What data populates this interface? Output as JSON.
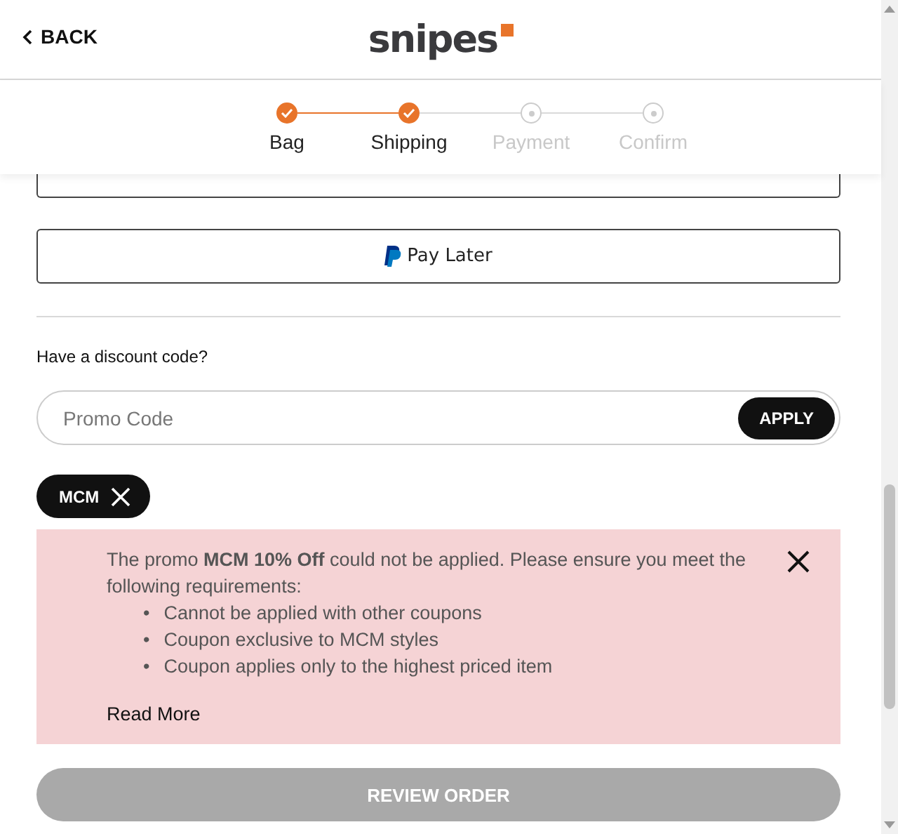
{
  "header": {
    "back": "BACK",
    "logo": "snipes"
  },
  "steps": [
    {
      "label": "Bag",
      "done": true
    },
    {
      "label": "Shipping",
      "done": true
    },
    {
      "label": "Payment",
      "done": false
    },
    {
      "label": "Confirm",
      "done": false
    }
  ],
  "pay_later": "Pay Later",
  "discount": {
    "label": "Have a discount code?",
    "placeholder": "Promo Code",
    "apply": "APPLY",
    "chips": [
      "MCM"
    ]
  },
  "alert": {
    "message": "The promo **MCM 10% Off** could not be applied. Please ensure you meet the following requirements:",
    "requirements": [
      {
        "bullet": "•",
        "text": "Cannot be applied with other coupons"
      },
      {
        "bullet": "•",
        "text": "Coupon exclusive to MCM styles"
      },
      {
        "bullet": "•",
        "text": "Coupon applies only to the highest priced item"
      }
    ],
    "link": "Read More"
  },
  "review": {
    "label": "REVIEW ORDER",
    "disabled": true
  }
}
